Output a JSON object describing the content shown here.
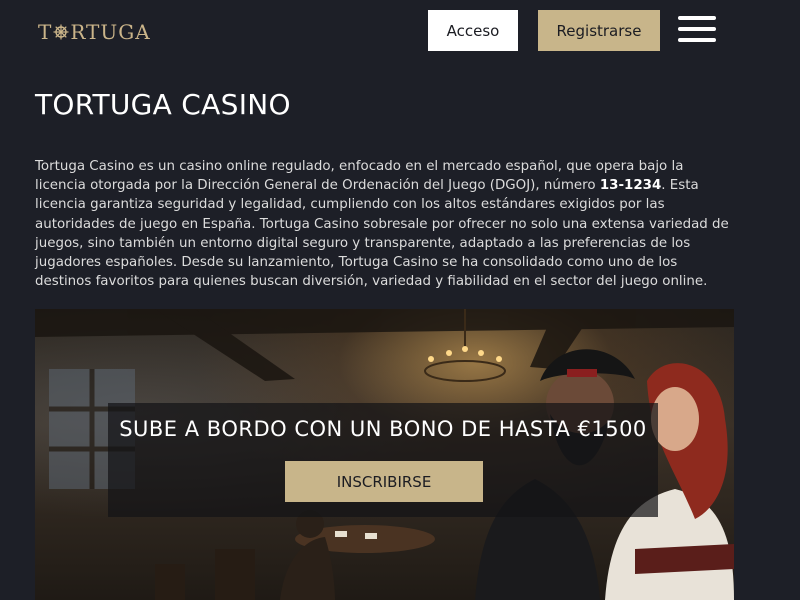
{
  "header": {
    "logo_left": "T",
    "logo_right": "RTUGA",
    "login_label": "Acceso",
    "register_label": "Registrarse"
  },
  "main": {
    "title": "TORTUGA CASINO",
    "intro_part1": "Tortuga Casino es un casino online regulado, enfocado en el mercado español, que opera bajo la licencia otorgada por la Dirección General de Ordenación del Juego (DGOJ), número ",
    "intro_license": "13-1234",
    "intro_part2": ". Esta licencia garantiza seguridad y legalidad, cumpliendo con los altos estándares exigidos por las autoridades de juego en España. Tortuga Casino sobresale por ofrecer no solo una extensa variedad de juegos, sino también un entorno digital seguro y transparente, adaptado a las preferencias de los jugadores españoles. Desde su lanzamiento, Tortuga Casino se ha consolidado como uno de los destinos favoritos para quienes buscan diversión, variedad y fiabilidad en el sector del juego online."
  },
  "hero": {
    "promo_title": "SUBE A BORDO CON UN BONO DE HASTA €1500",
    "cta_label": "INSCRIBIRSE"
  },
  "colors": {
    "background": "#1d1f27",
    "accent_gold": "#c8b58a",
    "logo_gold": "#cbb58a"
  },
  "icons": [
    "ship-wheel-icon",
    "hamburger-menu-icon"
  ]
}
